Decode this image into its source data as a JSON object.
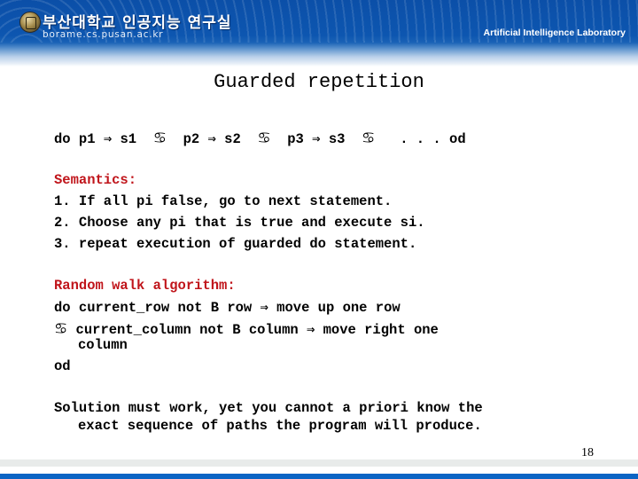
{
  "header": {
    "university": "부산대학교 인공지능 연구실",
    "url": "borame.cs.pusan.ac.kr",
    "lab_name": "Artificial Intelligence Laboratory"
  },
  "slide": {
    "title": "Guarded repetition",
    "guarded_do": {
      "keyword_do": "do",
      "clauses": [
        {
          "guard": "p1",
          "arrow": "⇒",
          "stmt": "s1"
        },
        {
          "guard": "p2",
          "arrow": "⇒",
          "stmt": "s2"
        },
        {
          "guard": "p3",
          "arrow": "⇒",
          "stmt": "s3"
        }
      ],
      "separator_symbol": "♋",
      "ellipsis": ". . .",
      "keyword_od": "od"
    },
    "semantics": {
      "heading": "Semantics:",
      "items": [
        "1. If all pi false, go to next statement.",
        "2. Choose any pi that is true and execute si.",
        "3. repeat execution of guarded do statement."
      ]
    },
    "random_walk": {
      "heading": "Random walk algorithm:",
      "line1": "do current_row not B row ⇒ move up one row",
      "line2_symbol": "♋",
      "line2": " current_column not B column ⇒ move right one",
      "line2_cont": "column",
      "line3": "od"
    },
    "conclusion": {
      "line1": "Solution must work, yet you cannot a priori know the",
      "line2": "exact sequence of paths the program will produce."
    },
    "page_number": "18"
  },
  "colors": {
    "header_blue": "#0b4fa8",
    "heading_red": "#c0151b",
    "footer_blue": "#0b64c4"
  }
}
